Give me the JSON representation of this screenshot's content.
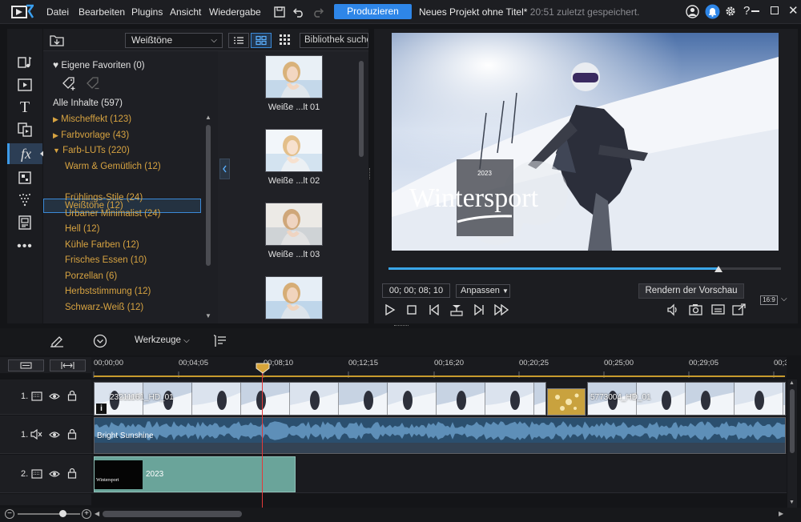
{
  "menu": {
    "items": [
      "Datei",
      "Bearbeiten",
      "Plugins",
      "Ansicht",
      "Wiedergabe"
    ],
    "produce_label": "Produzieren",
    "project_title": "Neues Projekt ohne Titel*",
    "save_status": "20:51 zuletzt gespeichert."
  },
  "library": {
    "filter_value": "Weißtöne",
    "search_placeholder": "Bibliothek suchen",
    "favorites_label": "Eigene Favoriten",
    "favorites_count": "(0)",
    "all_label": "Alle Inhalte",
    "all_count": "(597)",
    "categories": [
      {
        "label": "Mischeffekt",
        "count": "(123)"
      },
      {
        "label": "Farbvorlage",
        "count": "(43)"
      },
      {
        "label": "Farb-LUTs",
        "count": "(220)"
      }
    ],
    "subcategories": [
      {
        "label": "Warm & Gemütlich",
        "count": "(12)"
      },
      {
        "label": "Weißtöne",
        "count": "(12)"
      },
      {
        "label": "Frühlings-Stile",
        "count": "(24)"
      },
      {
        "label": "Urbaner Minimalist",
        "count": "(24)"
      },
      {
        "label": "Hell",
        "count": "(12)"
      },
      {
        "label": "Kühle Farben",
        "count": "(12)"
      },
      {
        "label": "Frisches Essen",
        "count": "(10)"
      },
      {
        "label": "Porzellan",
        "count": "(6)"
      },
      {
        "label": "Herbststimmung",
        "count": "(12)"
      },
      {
        "label": "Schwarz-Weiß",
        "count": "(12)"
      }
    ],
    "thumbnails": [
      "Weiße ...lt 01",
      "Weiße ...lt 02",
      "Weiße ...lt 03"
    ]
  },
  "preview": {
    "overlay_year": "2023",
    "overlay_title": "Wintersport",
    "timecode": "00; 00; 08; 10",
    "fit_label": "Anpassen",
    "render_label": "Rendern der Vorschau",
    "aspect_ratio": "16:9",
    "progress": 0.84
  },
  "tools": {
    "label": "Werkzeuge"
  },
  "timeline": {
    "ticks": [
      "00;00;00",
      "00;04;05",
      "00;08;10",
      "00;12;15",
      "00;16;20",
      "00;20;25",
      "00;25;00",
      "00;29;05",
      "00;3"
    ],
    "tracks": [
      {
        "number": "1.",
        "type": "video"
      },
      {
        "number": "1.",
        "type": "audio"
      },
      {
        "number": "2.",
        "type": "video"
      }
    ],
    "clip1_label": "23211161_HD_01",
    "clip2_label": "5773004_HD_01",
    "audio_label": "Bright Sunshine",
    "title_clip_label": "2023",
    "title_thumb_text": "Wintersport",
    "info_badge": "i"
  }
}
